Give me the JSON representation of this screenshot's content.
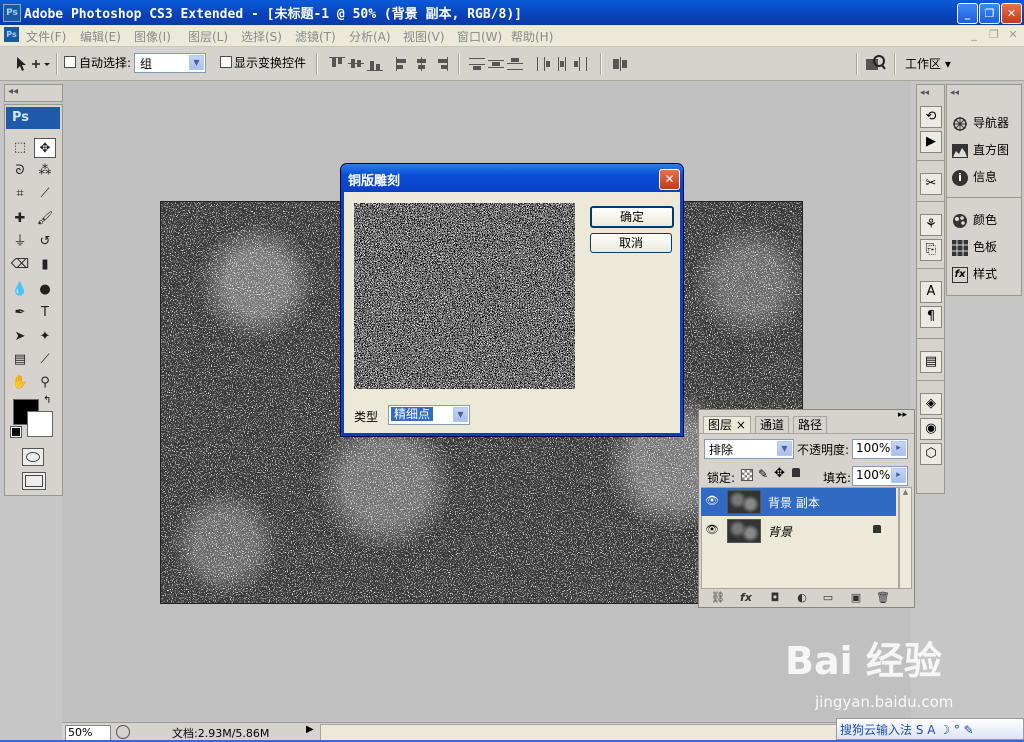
{
  "window": {
    "title": "Adobe Photoshop CS3 Extended - [未标题-1 @ 50% (背景 副本, RGB/8)]",
    "app_badge": "Ps",
    "minimize": "_",
    "restore": "❐",
    "close": "✕"
  },
  "menu": {
    "items": [
      "文件(F)",
      "编辑(E)",
      "图像(I)",
      "图层(L)",
      "选择(S)",
      "滤镜(T)",
      "分析(A)",
      "视图(V)",
      "窗口(W)",
      "帮助(H)"
    ],
    "mdi_buttons": [
      "_",
      "❐",
      "✕"
    ]
  },
  "options_bar": {
    "auto_select_label": "自动选择:",
    "auto_select_value": "组",
    "show_transform_label": "显示变换控件",
    "workspace_label": "工作区 ▾"
  },
  "toolbox": {
    "logo": "Ps",
    "collapse": "◂◂",
    "tools": [
      "rect-marquee",
      "move",
      "lasso",
      "magic-wand",
      "crop",
      "slice",
      "healing-brush",
      "brush",
      "clone-stamp",
      "history-brush",
      "eraser",
      "gradient",
      "blur",
      "dodge",
      "pen",
      "type",
      "path-select",
      "custom-shape",
      "notes",
      "eyedropper",
      "hand",
      "zoom"
    ],
    "type_glyph": "T",
    "foreground_color": "#000000",
    "background_color": "#ffffff"
  },
  "dock": {
    "collapse": "◂◂",
    "groups": [
      {
        "items": [
          {
            "label": "导航器",
            "icon": "navigator-icon"
          },
          {
            "label": "直方图",
            "icon": "histogram-icon"
          },
          {
            "label": "信息",
            "icon": "info-icon"
          }
        ]
      },
      {
        "items": [
          {
            "label": "颜色",
            "icon": "color-icon"
          },
          {
            "label": "色板",
            "icon": "swatches-icon"
          },
          {
            "label": "样式",
            "icon": "styles-icon"
          }
        ]
      }
    ],
    "info_glyph": "i",
    "styles_glyph": "fx"
  },
  "dialog": {
    "title": "铜版雕刻",
    "close": "✕",
    "ok_label": "确定",
    "cancel_label": "取消",
    "type_label": "类型",
    "type_value": "精细点",
    "dropdown_arrow": "▼"
  },
  "layers_panel": {
    "tabs": [
      {
        "label": "图层 ×",
        "active": true
      },
      {
        "label": "通道",
        "active": false
      },
      {
        "label": "路径",
        "active": false
      }
    ],
    "panel_menu": "▸▸",
    "blend_mode": "排除",
    "opacity_label": "不透明度:",
    "opacity_value": "100%",
    "lock_label": "锁定:",
    "fill_label": "填充:",
    "fill_value": "100%",
    "layers": [
      {
        "name": "背景 副本",
        "selected": true,
        "locked": false
      },
      {
        "name": "背景",
        "selected": false,
        "locked": true
      }
    ],
    "footer_glyphs": [
      "⛓",
      "fx",
      "◘",
      "◐",
      "▭",
      "▣",
      "🗑"
    ]
  },
  "status_bar": {
    "zoom": "50%",
    "doc_info": "文档:2.93M/5.86M",
    "arrow": "▶"
  },
  "watermark": {
    "brand": "Bai 经验",
    "url": "jingyan.baidu.com"
  },
  "sogou_bar": {
    "text": "搜狗云输入法 S A ☽ ° ✎"
  }
}
